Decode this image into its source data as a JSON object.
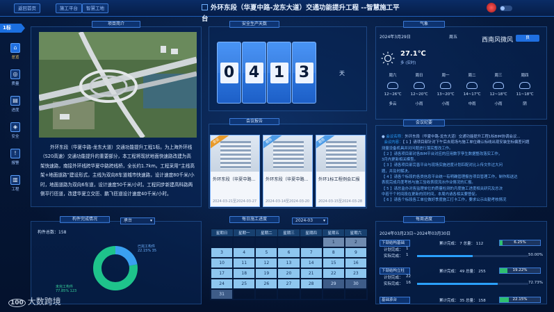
{
  "header": {
    "buttons": [
      "返回首页",
      "施工平台",
      "智慧工地"
    ],
    "title": "外环东段（华夏中路-龙东大道）交通功能提升工程 --智慧施工平台"
  },
  "side": {
    "section_tab": "1标",
    "items": [
      "总览",
      "质量",
      "进度",
      "安全",
      "报警",
      "工程"
    ]
  },
  "project": {
    "title": "项目简介",
    "description": "外环东段（华夏中路-龙东大道）交通功能提升工程1标。为上海外环线（S20高速）交通功能提升的重要部分，本工程将现状地面快速路改建为高架快速路，南接外环线跨华夏中路跨线桥，全长约1.7km。工程采用“主线高架+地面道路”建设形式，主线为双向8车道城市快速路，设计速度80千米/小时，地面道路为双向6车道，设计速度50千米/小时。工程同步新建高科路两侧平行匝道，改建华夏立交匝、鹏飞匝道设计速度40千米/小时。"
  },
  "safety": {
    "title": "安全生产天数",
    "digits": [
      "0",
      "4",
      "1",
      "3"
    ],
    "unit": "天"
  },
  "meetings": {
    "title": "会议报告",
    "cards": [
      {
        "tag": "会议",
        "title": "外环东段（华夏中路...",
        "date": "2024-03-21至2024-03-27"
      },
      {
        "tag": "报告",
        "title": "外环东段（华夏中路...",
        "date": "2024-03-14至2024-03-20"
      },
      {
        "tag": "报告",
        "title": "外环1标工程例会汇报",
        "date": "2024-03-15至2024-03-28"
      }
    ]
  },
  "weather": {
    "title": "气象",
    "date": "2024年3月29日",
    "weekday": "周五",
    "wind": "西南风微风",
    "wind_btn": "良",
    "temp": "27.1℃",
    "temp_sub": "多  (实时)",
    "forecast": [
      {
        "day": "周六",
        "range": "12~26℃",
        "desc": "多云"
      },
      {
        "day": "周日",
        "range": "12~20℃",
        "desc": "小雨"
      },
      {
        "day": "周一",
        "range": "13~20℃",
        "desc": "小雨"
      },
      {
        "day": "周二",
        "range": "14~17℃",
        "desc": "中雨"
      },
      {
        "day": "周三",
        "range": "12~18℃",
        "desc": "小雨"
      },
      {
        "day": "周四",
        "range": "11~18℃",
        "desc": "阴"
      }
    ]
  },
  "records": {
    "title": "会议纪要",
    "header_label": "会议名称：",
    "header_value": "外环东段（华夏中路-龙东大道）交通功能提升工程1标BIM协调会议...",
    "sub_label": "会议内容：",
    "lines": [
      "【 1 】请项目部针对下午后去现场与施工单位确认标线出现安装坐标偏差问题",
      "测量设备机具并对问题进行落实整改工作。",
      "【 2 】请各项目部对各BIM平台对应的应用数字孪生数据整改落实工作，",
      "3月内更新相关模型。",
      "【 3 】请各项目部完善平台与现场实施进度计划匹配对比上传文件过大问",
      "题，并及时解决。",
      "【 4 】请各个标段的各类信息平台统一有明确管理报告项目管理工作，制作和送达",
      "表现完成月度考核与施工验收表现流水作业情况的汇报。",
      "【 5 】请总监办对各监理单位的质量检测的月度施工进度相关研究及总决",
      "中若干个时间段在更新的同时间，本周内请各相关要督促。",
      "【 6 】请各个标段各工单位做好季度施工打卡工作，要求公示出勤考核情况"
    ]
  },
  "components": {
    "title": "构件完成情况",
    "select": "承台",
    "total_label": "构件总数：158",
    "legend_done": "已完工构件",
    "legend_done_val": "22.15% 35",
    "legend_todo": "未完工构件",
    "legend_todo_val": "77.85% 123",
    "done": 35,
    "todo": 123,
    "colors": {
      "done": "#3aa0f0",
      "todo": "#1ec38b"
    }
  },
  "calendar": {
    "title": "每日施工进度",
    "month": "2024-03",
    "weekdays": [
      "星期日",
      "星期一",
      "星期二",
      "星期三",
      "星期四",
      "星期五",
      "星期六"
    ],
    "days": [
      "1",
      "2",
      "3",
      "4",
      "5",
      "6",
      "7",
      "8",
      "9",
      "10",
      "11",
      "12",
      "13",
      "14",
      "15",
      "16",
      "17",
      "18",
      "19",
      "20",
      "21",
      "22",
      "23",
      "24",
      "25",
      "26",
      "27",
      "28",
      "29",
      "30",
      "31"
    ]
  },
  "progress": {
    "title": "每周进度",
    "range": "2024年03月23日~2024年03月30日",
    "groups": [
      {
        "name": "下部结构基础",
        "stat": "累计完成：  7  总量：  112",
        "pct": "6.25%",
        "pct_value": 6.25,
        "rows": [
          {
            "lab": "计划完成：",
            "val": "1",
            "pct": ""
          },
          {
            "lab": "实际完成：",
            "val": "1",
            "pct": "50.00%",
            "fill": 50
          }
        ]
      },
      {
        "name": "下部结构立柱",
        "stat": "累计完成：  49  总量：  255",
        "pct": "19.22%",
        "pct_value": 19.22,
        "rows": [
          {
            "lab": "计划完成：",
            "val": "22",
            "pct": ""
          },
          {
            "lab": "实际完成：",
            "val": "16",
            "pct": "72.73%",
            "fill": 72.73
          }
        ]
      },
      {
        "name": "基础承台",
        "stat": "累计完成：  35  总量：  158",
        "pct": "22.15%",
        "pct_value": 22.15,
        "rows": []
      }
    ]
  },
  "watermark": {
    "logo": "100",
    "text": "大数跨境"
  }
}
